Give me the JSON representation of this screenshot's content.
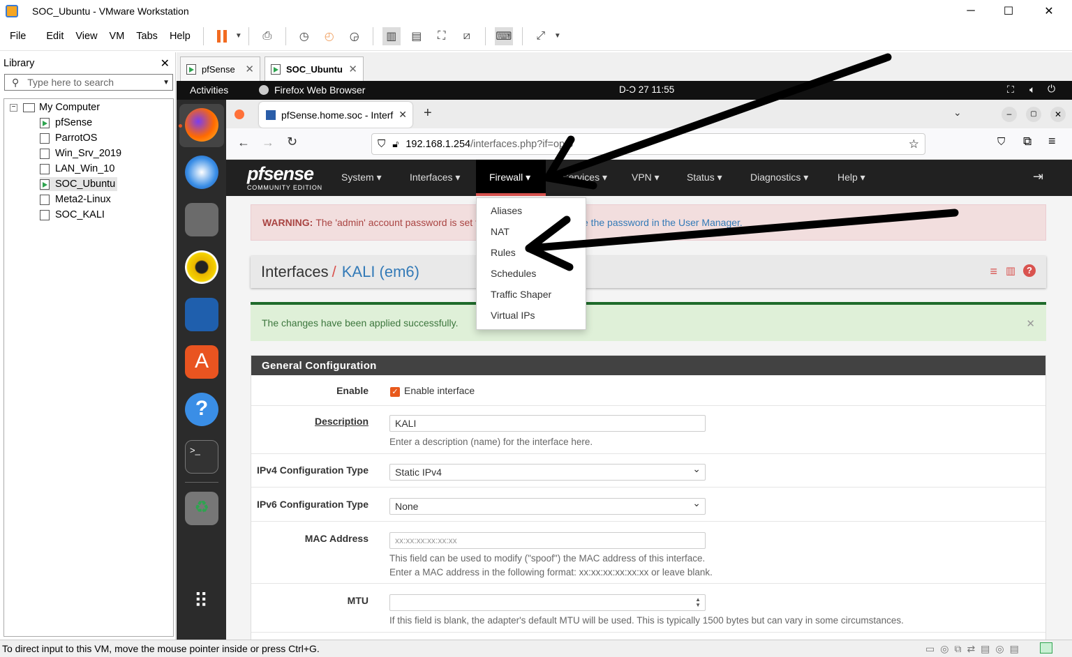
{
  "window": {
    "title": "SOC_Ubuntu - VMware Workstation"
  },
  "menu": [
    "File",
    "Edit",
    "View",
    "VM",
    "Tabs",
    "Help"
  ],
  "library": {
    "title": "Library",
    "search_placeholder": "Type here to search",
    "root": "My Computer",
    "vms": [
      "pfSense",
      "ParrotOS",
      "Win_Srv_2019",
      "LAN_Win_10",
      "SOC_Ubuntu",
      "Meta2-Linux",
      "SOC_KALI"
    ]
  },
  "tabs": [
    "pfSense",
    "SOC_Ubuntu"
  ],
  "ubuntu": {
    "activities": "Activities",
    "app": "Firefox Web Browser",
    "clock": "D-Ͻ 27  11:55"
  },
  "firefox": {
    "tab_title": "pfSense.home.soc - Interf",
    "url_host": "192.168.1.254",
    "url_path": "/interfaces.php?if=opt5"
  },
  "pfsense": {
    "logo": "pfsense",
    "edition": "COMMUNITY EDITION",
    "nav": [
      "System",
      "Interfaces",
      "Firewall",
      "Services",
      "VPN",
      "Status",
      "Diagnostics",
      "Help"
    ],
    "firewall_menu": [
      "Aliases",
      "NAT",
      "Rules",
      "Schedules",
      "Traffic Shaper",
      "Virtual IPs"
    ],
    "warning_label": "WARNING:",
    "warning_text": "The 'admin' account password is set to the default value. Change the password in the User Manager.",
    "warning_visible_left": "The 'admin' account password is set to",
    "warning_visible_right": "e the password in the User Manager.",
    "breadcrumb_1": "Interfaces",
    "breadcrumb_sep": "/",
    "breadcrumb_2": "KALI (em6)",
    "success": "The changes have been applied successfully.",
    "panel_title": "General Configuration",
    "fields": {
      "enable_label": "Enable",
      "enable_text": "Enable interface",
      "desc_label": "Description",
      "desc_value": "KALI",
      "desc_help": "Enter a description (name) for the interface here.",
      "ipv4_label": "IPv4 Configuration Type",
      "ipv4_value": "Static IPv4",
      "ipv6_label": "IPv6 Configuration Type",
      "ipv6_value": "None",
      "mac_label": "MAC Address",
      "mac_placeholder": "xx:xx:xx:xx:xx:xx",
      "mac_help1": "This field can be used to modify (\"spoof\") the MAC address of this interface.",
      "mac_help2": "Enter a MAC address in the following format: xx:xx:xx:xx:xx:xx or leave blank.",
      "mtu_label": "MTU",
      "mtu_help": "If this field is blank, the adapter's default MTU will be used. This is typically 1500 bytes but can vary in some circumstances."
    },
    "colors": {
      "nav_bg": "#212121",
      "accent": "#d9534f",
      "link": "#337ab7"
    }
  },
  "status": "To direct input to this VM, move the mouse pointer inside or press Ctrl+G."
}
